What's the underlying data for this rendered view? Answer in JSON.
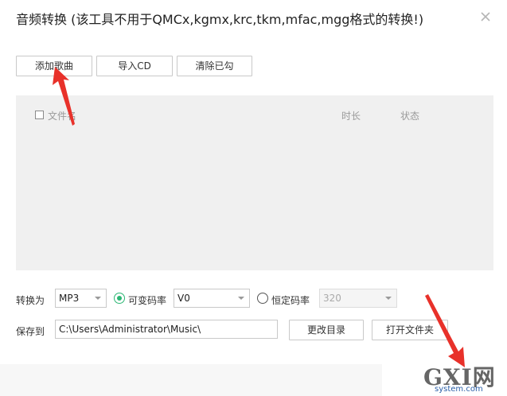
{
  "window": {
    "title": "音频转换 (该工具不用于QMCx,kgmx,krc,tkm,mfac,mgg格式的转换!)"
  },
  "toolbar": {
    "add_song": "添加歌曲",
    "import_cd": "导入CD",
    "clear_checked": "清除已勾"
  },
  "list": {
    "col_filename": "文件名",
    "col_duration": "时长",
    "col_status": "状态",
    "select_all_checked": false
  },
  "convert": {
    "label": "转换为",
    "format_value": "MP3",
    "vbr_label": "可变码率",
    "vbr_selected": true,
    "vbr_value": "V0",
    "cbr_label": "恒定码率",
    "cbr_selected": false,
    "cbr_value": "320"
  },
  "save": {
    "label": "保存到",
    "path": "C:\\Users\\Administrator\\Music\\",
    "change_dir": "更改目录",
    "open_folder": "打开文件夹"
  },
  "watermark": {
    "main": "GXI网",
    "sub": "system.com"
  },
  "colors": {
    "accent": "#2bb673",
    "annotation_red": "#e8312a"
  }
}
